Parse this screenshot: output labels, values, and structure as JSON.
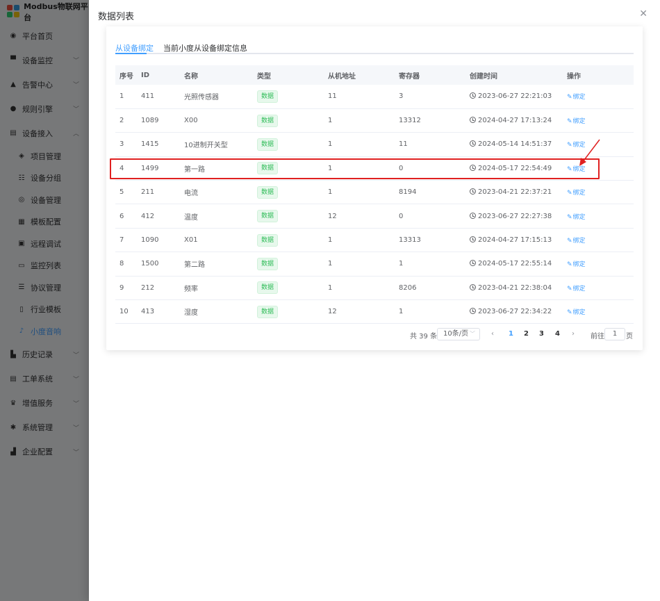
{
  "app": {
    "title": "Modbus物联网平台"
  },
  "sidebar": {
    "items": [
      {
        "label": "平台首页",
        "icon": "dashboard-icon",
        "glyph": "◉",
        "chevron": false
      },
      {
        "label": "设备监控",
        "icon": "monitor-icon",
        "glyph": "▀",
        "chevron": true
      },
      {
        "label": "告警中心",
        "icon": "bell-icon",
        "glyph": "▲",
        "chevron": true
      },
      {
        "label": "规则引擎",
        "icon": "engine-icon",
        "glyph": "●",
        "chevron": true
      },
      {
        "label": "设备接入",
        "icon": "access-icon",
        "glyph": "▤",
        "chevron": true,
        "expanded": true
      }
    ],
    "subitems": [
      {
        "label": "项目管理",
        "icon": "layers-icon",
        "glyph": "◈"
      },
      {
        "label": "设备分组",
        "icon": "group-icon",
        "glyph": "☷"
      },
      {
        "label": "设备管理",
        "icon": "device-icon",
        "glyph": "◎"
      },
      {
        "label": "模板配置",
        "icon": "template-icon",
        "glyph": "▦"
      },
      {
        "label": "远程调试",
        "icon": "debug-icon",
        "glyph": "▣"
      },
      {
        "label": "监控列表",
        "icon": "camera-icon",
        "glyph": "▭"
      },
      {
        "label": "协议管理",
        "icon": "list-icon",
        "glyph": "☰"
      },
      {
        "label": "行业模板",
        "icon": "folder-icon",
        "glyph": "▯"
      },
      {
        "label": "小度音响",
        "icon": "speaker-icon",
        "glyph": "♪",
        "active": true
      }
    ],
    "bottom_items": [
      {
        "label": "历史记录",
        "icon": "chart-icon",
        "glyph": "▙",
        "chevron": true
      },
      {
        "label": "工单系统",
        "icon": "ticket-icon",
        "glyph": "▤",
        "chevron": true
      },
      {
        "label": "增值服务",
        "icon": "crown-icon",
        "glyph": "♛",
        "chevron": true
      },
      {
        "label": "系统管理",
        "icon": "gear-icon",
        "glyph": "✱",
        "chevron": true
      },
      {
        "label": "企业配置",
        "icon": "building-icon",
        "glyph": "▟",
        "chevron": true
      }
    ]
  },
  "drawer": {
    "title": "数据列表",
    "tabs": [
      {
        "label": "从设备绑定",
        "active": true
      },
      {
        "label": "当前小度从设备绑定信息",
        "active": false
      }
    ],
    "table": {
      "columns": [
        "序号",
        "ID",
        "名称",
        "类型",
        "从机地址",
        "寄存器",
        "创建时间",
        "操作"
      ],
      "rows": [
        {
          "idx": "1",
          "id": "411",
          "name": "光照传感器",
          "type": "数据",
          "slave": "11",
          "reg": "3",
          "time": "2023-06-27 22:21:03",
          "action": "绑定"
        },
        {
          "idx": "2",
          "id": "1089",
          "name": "X00",
          "type": "数据",
          "slave": "1",
          "reg": "13312",
          "time": "2024-04-27 17:13:24",
          "action": "绑定"
        },
        {
          "idx": "3",
          "id": "1415",
          "name": "10进制开关型",
          "type": "数据",
          "slave": "1",
          "reg": "11",
          "time": "2024-05-14 14:51:37",
          "action": "绑定"
        },
        {
          "idx": "4",
          "id": "1499",
          "name": "第一路",
          "type": "数据",
          "slave": "1",
          "reg": "0",
          "time": "2024-05-17 22:54:49",
          "action": "绑定"
        },
        {
          "idx": "5",
          "id": "211",
          "name": "电流",
          "type": "数据",
          "slave": "1",
          "reg": "8194",
          "time": "2023-04-21 22:37:21",
          "action": "绑定"
        },
        {
          "idx": "6",
          "id": "412",
          "name": "温度",
          "type": "数据",
          "slave": "12",
          "reg": "0",
          "time": "2023-06-27 22:27:38",
          "action": "绑定"
        },
        {
          "idx": "7",
          "id": "1090",
          "name": "X01",
          "type": "数据",
          "slave": "1",
          "reg": "13313",
          "time": "2024-04-27 17:15:13",
          "action": "绑定"
        },
        {
          "idx": "8",
          "id": "1500",
          "name": "第二路",
          "type": "数据",
          "slave": "1",
          "reg": "1",
          "time": "2024-05-17 22:55:14",
          "action": "绑定"
        },
        {
          "idx": "9",
          "id": "212",
          "name": "频率",
          "type": "数据",
          "slave": "1",
          "reg": "8206",
          "time": "2023-04-21 22:38:04",
          "action": "绑定"
        },
        {
          "idx": "10",
          "id": "413",
          "name": "湿度",
          "type": "数据",
          "slave": "12",
          "reg": "1",
          "time": "2023-06-27 22:34:22",
          "action": "绑定"
        }
      ]
    },
    "pagination": {
      "total": "共 39 条",
      "page_size": "10条/页",
      "pages": [
        "1",
        "2",
        "3",
        "4"
      ],
      "current": "1",
      "goto_label": "前往",
      "goto_value": "1",
      "page_unit": "页"
    }
  },
  "colors": {
    "accent": "#409eff",
    "tag_green": "#2fbc58",
    "highlight_red": "#e02020"
  }
}
